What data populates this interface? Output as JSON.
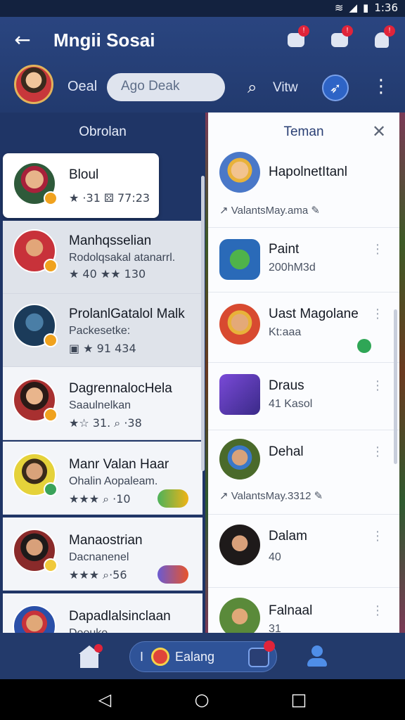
{
  "status_bar": {
    "time": "1:36",
    "wifi_icon": "wifi-icon",
    "signal_icon": "signal-icon",
    "battery_icon": "battery-icon"
  },
  "app_bar": {
    "title": "Mngii Sosai",
    "back_icon": "arrow-left-icon",
    "user_name": "Oeal",
    "search_placeholder": "Ago Deak",
    "view_label": "Vitw",
    "icons": [
      "chat-icon",
      "notification-icon",
      "friend-icon",
      "compass-icon",
      "more-vert-icon"
    ]
  },
  "left_panel": {
    "title": "Obrolan",
    "chats": [
      {
        "name": "Bloul",
        "sub": "",
        "meta": "★ ·31  ⚄ 77:23"
      },
      {
        "name": "Manhqsselian",
        "sub": "Rodolqsakal atanarrl.",
        "meta": "★ 40 ★★ 130"
      },
      {
        "name": "ProlanlGatalol Malk",
        "sub": "Packesetke:",
        "meta": "▣ ★ 91 434"
      },
      {
        "name": "DagrennalocHela",
        "sub": "Saaulnelkan",
        "meta": "★☆ 31. ⌕ ·38"
      },
      {
        "name": "Manr Valan Haar",
        "sub": "Ohalin Aopaleam.",
        "meta": "★★★ ⌕ ·10"
      },
      {
        "name": "Manaostrian",
        "sub": "Dacnanenel",
        "meta": "★★★ ⌕·56"
      },
      {
        "name": "Dapadlalsinclaan",
        "sub": "Deeuke",
        "meta": ""
      }
    ]
  },
  "right_panel": {
    "title": "Teman",
    "friends": [
      {
        "name": "HapolnetItanl",
        "sub": "",
        "note": "↗ ValantsMay.ama ✎"
      },
      {
        "name": "Paint",
        "sub": "200hM3d",
        "note": ""
      },
      {
        "name": "Uast Magolane",
        "sub": "Kt:aaa",
        "note": ""
      },
      {
        "name": "Draus",
        "sub": "41 Kasol",
        "note": ""
      },
      {
        "name": "Dehal",
        "sub": "",
        "note": "↗ ValantsMay.3312 ✎"
      },
      {
        "name": "Dalam",
        "sub": "40",
        "note": ""
      },
      {
        "name": "Falnaal",
        "sub": "31",
        "note": ""
      }
    ]
  },
  "bottom_nav": {
    "pill_prefix": "I",
    "pill_label": "Ealang",
    "items": [
      "home-icon",
      "chat-pill",
      "profile-icon"
    ]
  },
  "system_nav": {
    "back": "◁",
    "home": "○",
    "recents": "□"
  },
  "colors": {
    "app_bar": "#2a4580",
    "accent": "#2e64c6",
    "badge": "#e0243a",
    "star": "#f0b316"
  }
}
